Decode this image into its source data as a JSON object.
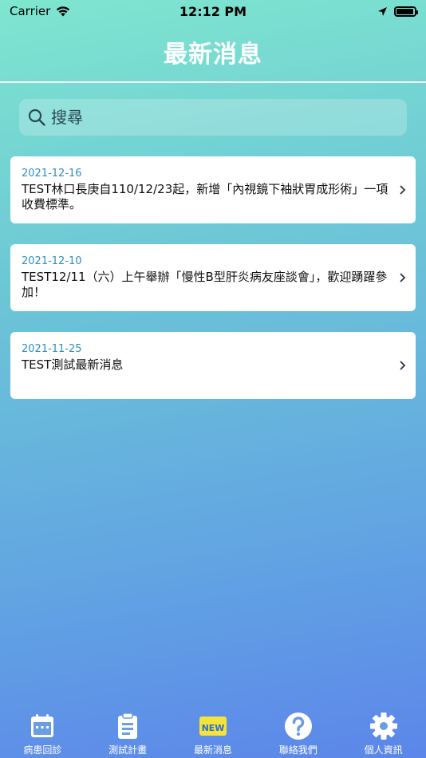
{
  "status_bar": {
    "carrier": "Carrier",
    "time": "12:12 PM",
    "battery_level": 0.95
  },
  "header": {
    "title": "最新消息"
  },
  "search": {
    "placeholder": "搜尋"
  },
  "news": [
    {
      "date": "2021-12-16",
      "title": "TEST林口長庚自110/12/23起，新增「內視鏡下袖狀胃成形術」一項收費標準。"
    },
    {
      "date": "2021-12-10",
      "title": "TEST12/11（六）上午舉辦「慢性B型肝炎病友座談會」，歡迎踴躍參加！"
    },
    {
      "date": "2021-11-25",
      "title": "TEST測試最新消息"
    }
  ],
  "tabbar": {
    "tabs": [
      {
        "label": "病患回診",
        "icon": "calendar-icon"
      },
      {
        "label": "測試計畫",
        "icon": "clipboard-icon"
      },
      {
        "label": "最新消息",
        "icon": "new-badge-icon",
        "badge_text": "NEW",
        "active": true
      },
      {
        "label": "聯絡我們",
        "icon": "question-icon"
      },
      {
        "label": "個人資訊",
        "icon": "gear-icon"
      }
    ]
  },
  "colors": {
    "accent_date": "#2f8fbf",
    "new_badge": "#f5e23a"
  }
}
